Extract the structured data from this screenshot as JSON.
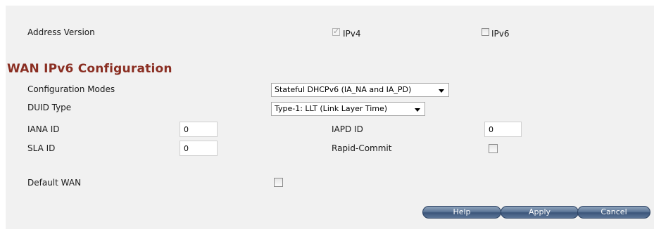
{
  "address_version": {
    "label": "Address Version",
    "ipv4": {
      "label": "IPv4",
      "checked": true,
      "disabled": true
    },
    "ipv6": {
      "label": "IPv6",
      "checked": false
    }
  },
  "section_title": "WAN IPv6 Configuration",
  "fields": {
    "config_modes": {
      "label": "Configuration Modes",
      "value": "Stateful DHCPv6 (IA_NA and IA_PD)"
    },
    "duid_type": {
      "label": "DUID Type",
      "value": "Type-1: LLT (Link Layer Time)"
    },
    "iana_id": {
      "label": "IANA ID",
      "value": "0"
    },
    "iapd_id": {
      "label": "IAPD ID",
      "value": "0"
    },
    "sla_id": {
      "label": "SLA ID",
      "value": "0"
    },
    "rapid_commit": {
      "label": "Rapid-Commit",
      "checked": false
    },
    "default_wan": {
      "label": "Default WAN",
      "checked": false
    }
  },
  "buttons": {
    "help": "Help",
    "apply": "Apply",
    "cancel": "Cancel"
  },
  "colors": {
    "title": "#8a2e22",
    "panel": "#f1f1f1",
    "button": "#4a6689"
  }
}
